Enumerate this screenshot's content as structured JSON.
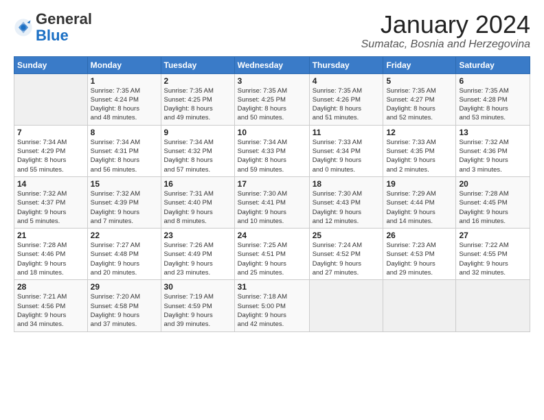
{
  "header": {
    "logo_general": "General",
    "logo_blue": "Blue",
    "month": "January 2024",
    "location": "Sumatac, Bosnia and Herzegovina"
  },
  "weekdays": [
    "Sunday",
    "Monday",
    "Tuesday",
    "Wednesday",
    "Thursday",
    "Friday",
    "Saturday"
  ],
  "weeks": [
    [
      {
        "day": "",
        "info": ""
      },
      {
        "day": "1",
        "info": "Sunrise: 7:35 AM\nSunset: 4:24 PM\nDaylight: 8 hours\nand 48 minutes."
      },
      {
        "day": "2",
        "info": "Sunrise: 7:35 AM\nSunset: 4:25 PM\nDaylight: 8 hours\nand 49 minutes."
      },
      {
        "day": "3",
        "info": "Sunrise: 7:35 AM\nSunset: 4:25 PM\nDaylight: 8 hours\nand 50 minutes."
      },
      {
        "day": "4",
        "info": "Sunrise: 7:35 AM\nSunset: 4:26 PM\nDaylight: 8 hours\nand 51 minutes."
      },
      {
        "day": "5",
        "info": "Sunrise: 7:35 AM\nSunset: 4:27 PM\nDaylight: 8 hours\nand 52 minutes."
      },
      {
        "day": "6",
        "info": "Sunrise: 7:35 AM\nSunset: 4:28 PM\nDaylight: 8 hours\nand 53 minutes."
      }
    ],
    [
      {
        "day": "7",
        "info": "Sunrise: 7:34 AM\nSunset: 4:29 PM\nDaylight: 8 hours\nand 55 minutes."
      },
      {
        "day": "8",
        "info": "Sunrise: 7:34 AM\nSunset: 4:31 PM\nDaylight: 8 hours\nand 56 minutes."
      },
      {
        "day": "9",
        "info": "Sunrise: 7:34 AM\nSunset: 4:32 PM\nDaylight: 8 hours\nand 57 minutes."
      },
      {
        "day": "10",
        "info": "Sunrise: 7:34 AM\nSunset: 4:33 PM\nDaylight: 8 hours\nand 59 minutes."
      },
      {
        "day": "11",
        "info": "Sunrise: 7:33 AM\nSunset: 4:34 PM\nDaylight: 9 hours\nand 0 minutes."
      },
      {
        "day": "12",
        "info": "Sunrise: 7:33 AM\nSunset: 4:35 PM\nDaylight: 9 hours\nand 2 minutes."
      },
      {
        "day": "13",
        "info": "Sunrise: 7:32 AM\nSunset: 4:36 PM\nDaylight: 9 hours\nand 3 minutes."
      }
    ],
    [
      {
        "day": "14",
        "info": "Sunrise: 7:32 AM\nSunset: 4:37 PM\nDaylight: 9 hours\nand 5 minutes."
      },
      {
        "day": "15",
        "info": "Sunrise: 7:32 AM\nSunset: 4:39 PM\nDaylight: 9 hours\nand 7 minutes."
      },
      {
        "day": "16",
        "info": "Sunrise: 7:31 AM\nSunset: 4:40 PM\nDaylight: 9 hours\nand 8 minutes."
      },
      {
        "day": "17",
        "info": "Sunrise: 7:30 AM\nSunset: 4:41 PM\nDaylight: 9 hours\nand 10 minutes."
      },
      {
        "day": "18",
        "info": "Sunrise: 7:30 AM\nSunset: 4:43 PM\nDaylight: 9 hours\nand 12 minutes."
      },
      {
        "day": "19",
        "info": "Sunrise: 7:29 AM\nSunset: 4:44 PM\nDaylight: 9 hours\nand 14 minutes."
      },
      {
        "day": "20",
        "info": "Sunrise: 7:28 AM\nSunset: 4:45 PM\nDaylight: 9 hours\nand 16 minutes."
      }
    ],
    [
      {
        "day": "21",
        "info": "Sunrise: 7:28 AM\nSunset: 4:46 PM\nDaylight: 9 hours\nand 18 minutes."
      },
      {
        "day": "22",
        "info": "Sunrise: 7:27 AM\nSunset: 4:48 PM\nDaylight: 9 hours\nand 20 minutes."
      },
      {
        "day": "23",
        "info": "Sunrise: 7:26 AM\nSunset: 4:49 PM\nDaylight: 9 hours\nand 23 minutes."
      },
      {
        "day": "24",
        "info": "Sunrise: 7:25 AM\nSunset: 4:51 PM\nDaylight: 9 hours\nand 25 minutes."
      },
      {
        "day": "25",
        "info": "Sunrise: 7:24 AM\nSunset: 4:52 PM\nDaylight: 9 hours\nand 27 minutes."
      },
      {
        "day": "26",
        "info": "Sunrise: 7:23 AM\nSunset: 4:53 PM\nDaylight: 9 hours\nand 29 minutes."
      },
      {
        "day": "27",
        "info": "Sunrise: 7:22 AM\nSunset: 4:55 PM\nDaylight: 9 hours\nand 32 minutes."
      }
    ],
    [
      {
        "day": "28",
        "info": "Sunrise: 7:21 AM\nSunset: 4:56 PM\nDaylight: 9 hours\nand 34 minutes."
      },
      {
        "day": "29",
        "info": "Sunrise: 7:20 AM\nSunset: 4:58 PM\nDaylight: 9 hours\nand 37 minutes."
      },
      {
        "day": "30",
        "info": "Sunrise: 7:19 AM\nSunset: 4:59 PM\nDaylight: 9 hours\nand 39 minutes."
      },
      {
        "day": "31",
        "info": "Sunrise: 7:18 AM\nSunset: 5:00 PM\nDaylight: 9 hours\nand 42 minutes."
      },
      {
        "day": "",
        "info": ""
      },
      {
        "day": "",
        "info": ""
      },
      {
        "day": "",
        "info": ""
      }
    ]
  ]
}
